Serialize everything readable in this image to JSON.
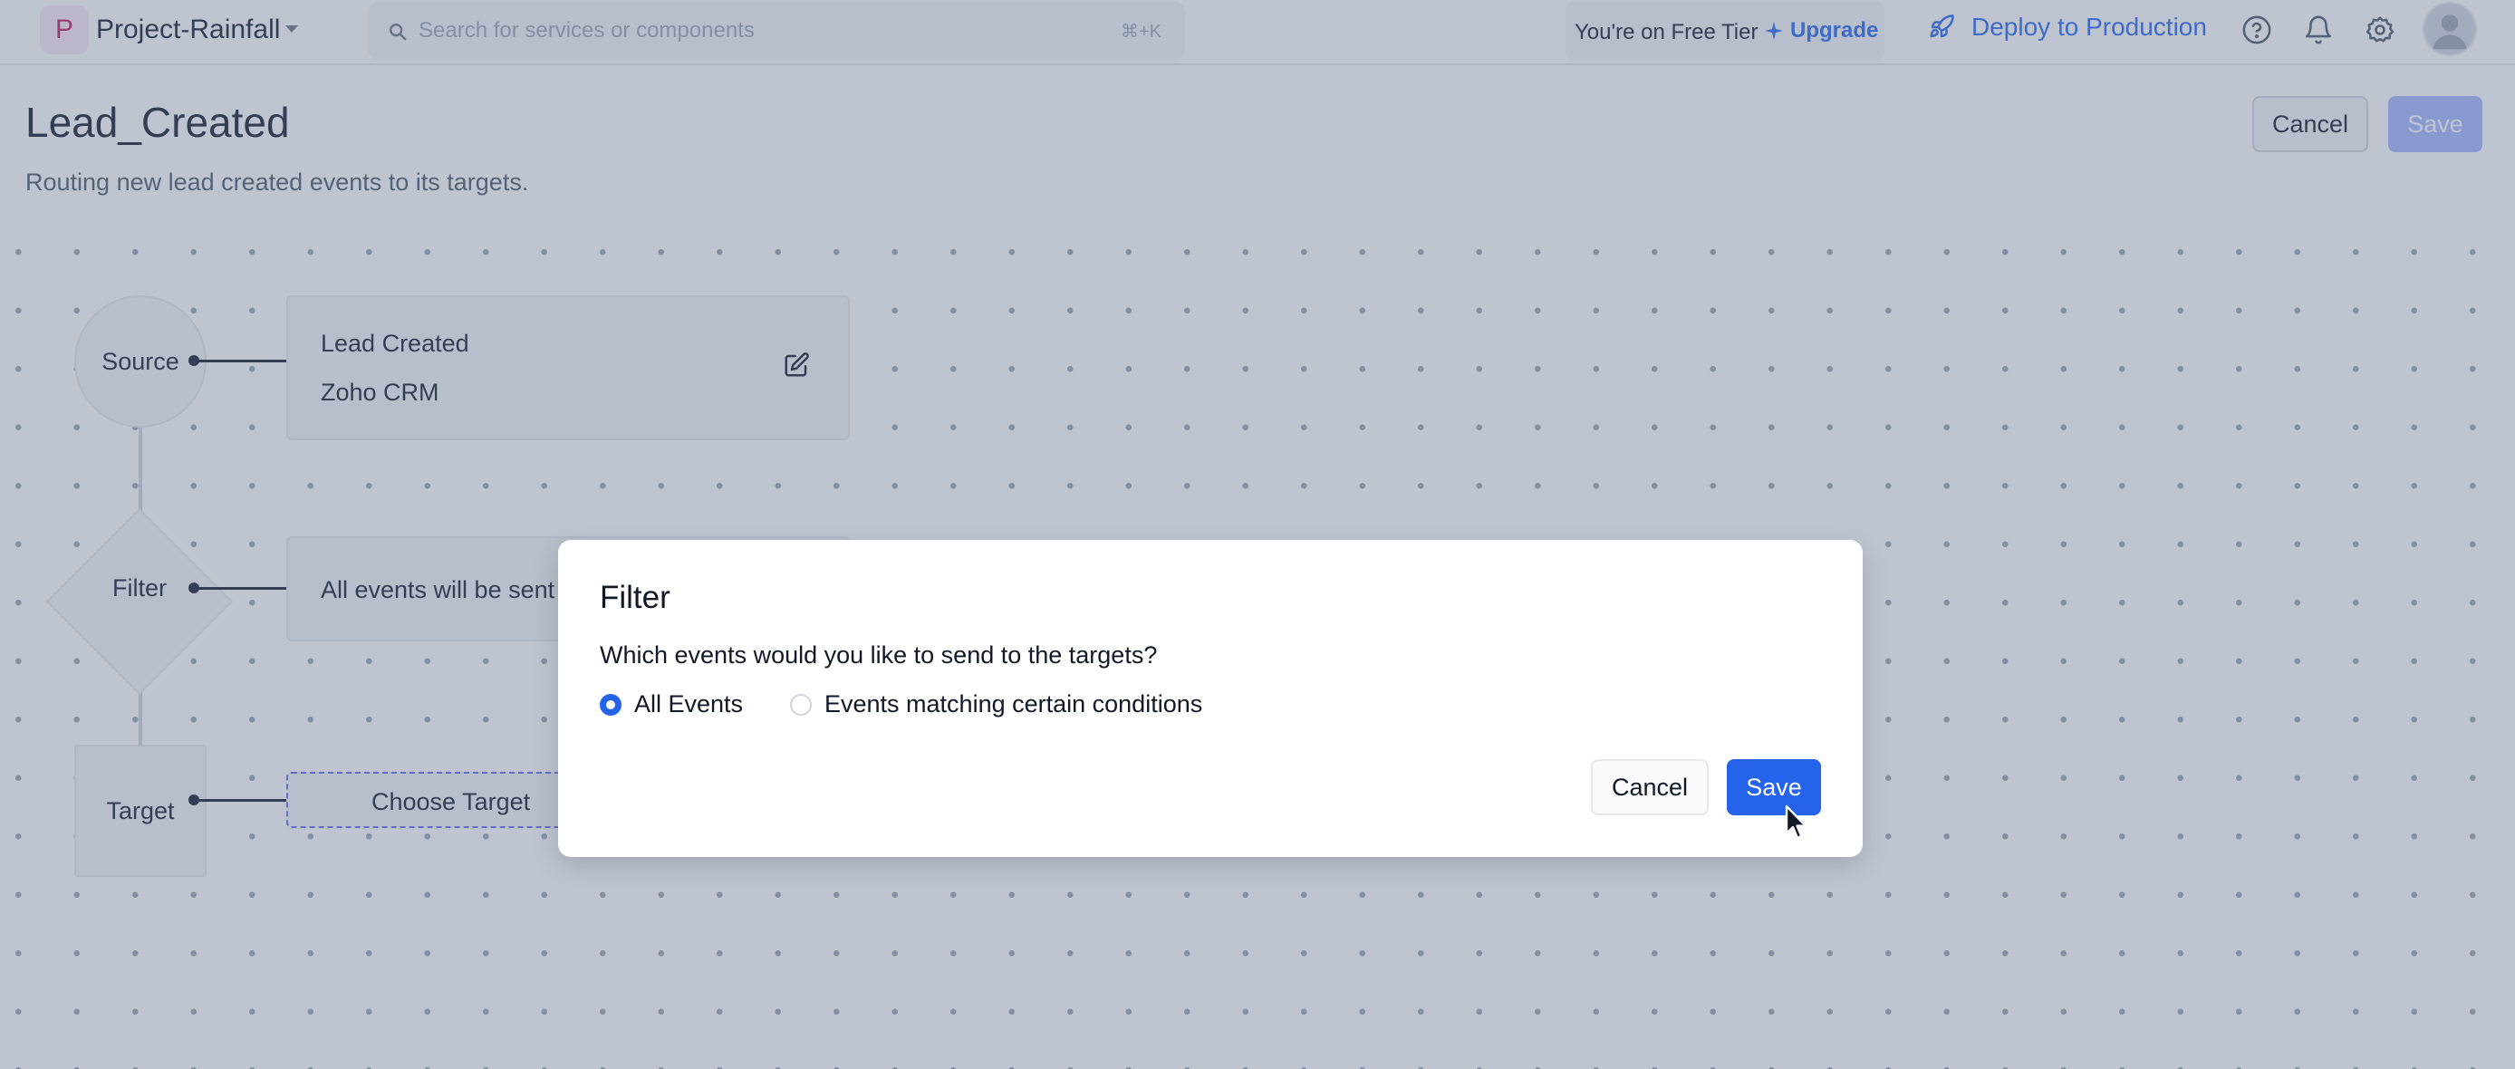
{
  "topbar": {
    "project_initial": "P",
    "project_name": "Project-Rainfall",
    "search_placeholder": "Search for services or components",
    "search_shortcut": "⌘+K",
    "tier_text": "You're on Free Tier",
    "upgrade_label": "Upgrade",
    "deploy_label": "Deploy to Production",
    "icons": [
      "chevron-down-icon",
      "search-icon",
      "sparkle-icon",
      "rocket-icon",
      "help-icon",
      "bell-icon",
      "gear-icon",
      "avatar"
    ]
  },
  "header": {
    "title": "Lead_Created",
    "description": "Routing new lead created events to its targets.",
    "cancel_label": "Cancel",
    "save_label": "Save"
  },
  "flow": {
    "source_label": "Source",
    "filter_label": "Filter",
    "target_label": "Target",
    "source_event": "Lead Created",
    "source_app": "Zoho CRM",
    "filter_summary": "All events will be sent",
    "choose_target": "Choose Target"
  },
  "modal": {
    "title": "Filter",
    "question": "Which events would you like to send to the targets?",
    "options": [
      {
        "label": "All Events",
        "selected": true
      },
      {
        "label": "Events matching certain conditions",
        "selected": false
      }
    ],
    "cancel_label": "Cancel",
    "save_label": "Save"
  },
  "colors": {
    "accent": "#2563eb",
    "disabled_save": "#a5b4fc",
    "project_badge": "#be185d"
  }
}
